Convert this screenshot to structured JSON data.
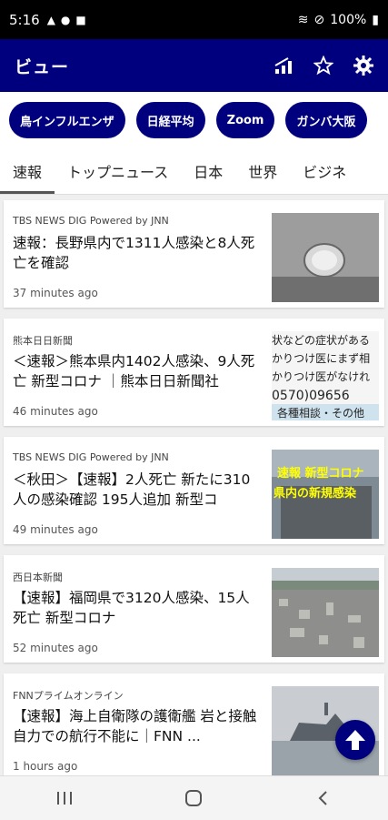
{
  "status": {
    "time": "5:16",
    "battery": "100%"
  },
  "appbar": {
    "title": "ビュー"
  },
  "chips": [
    "鳥インフルエンザ",
    "日経平均",
    "Zoom",
    "ガンバ大阪"
  ],
  "tabs": [
    "速報",
    "トップニュース",
    "日本",
    "世界",
    "ビジネ"
  ],
  "articles": [
    {
      "source": "TBS NEWS DIG Powered by JNN",
      "headline": "速報：長野県内で1311人感染と8人死亡を確認",
      "time": "37 minutes ago"
    },
    {
      "source": "熊本日日新聞",
      "headline": "＜速報＞熊本県内1402人感染、9人死亡 新型コロナ ｜熊本日日新聞社",
      "time": "46 minutes ago",
      "thumb_text": [
        "状などの症状がある",
        "かりつけ医にまず相",
        "かりつけ医がなけれ",
        "0570)09656",
        "各種相談・その他"
      ]
    },
    {
      "source": "TBS NEWS DIG Powered by JNN",
      "headline": "＜秋田＞【速報】2人死亡 新たに310人の感染確認 195人追加 新型コ",
      "time": "49 minutes ago",
      "thumb_text": [
        "速報 新型コロナ",
        "県内の新規感染"
      ]
    },
    {
      "source": "西日本新聞",
      "headline": "【速報】福岡県で3120人感染、15人死亡 新型コロナ",
      "time": "52 minutes ago"
    },
    {
      "source": "FNNプライムオンライン",
      "headline": "【速報】海上自衛隊の護衛艦 岩と接触 自力での航行不能に｜FNN ...",
      "time": "1 hours ago"
    }
  ],
  "colors": {
    "brand": "#00007e"
  }
}
